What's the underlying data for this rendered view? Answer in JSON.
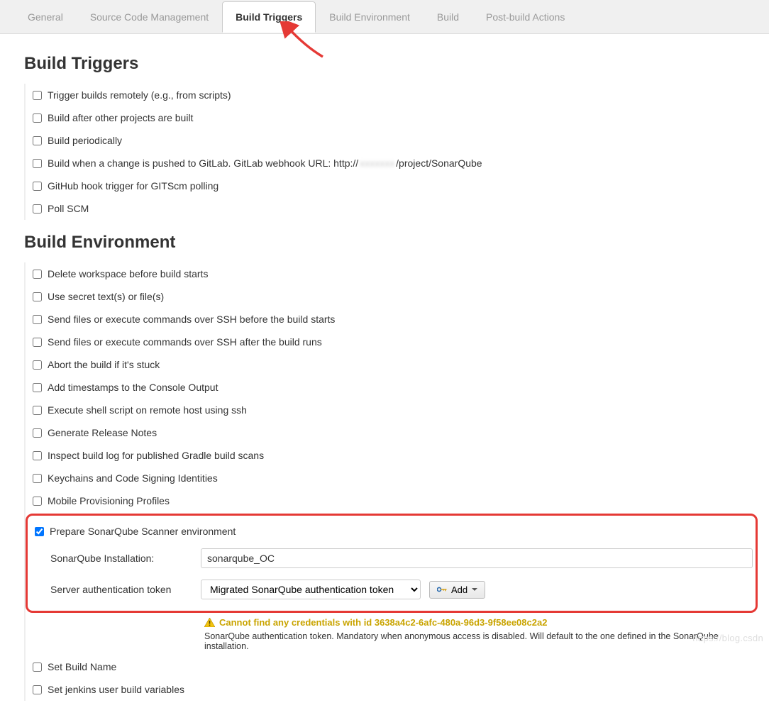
{
  "tabs": {
    "general": "General",
    "scm": "Source Code Management",
    "build_triggers": "Build Triggers",
    "build_env": "Build Environment",
    "build": "Build",
    "post_build": "Post-build Actions"
  },
  "sections": {
    "build_triggers_title": "Build Triggers",
    "build_env_title": "Build Environment"
  },
  "triggers": {
    "remote": "Trigger builds remotely (e.g., from scripts)",
    "after_other": "Build after other projects are built",
    "periodic": "Build periodically",
    "gitlab_prefix": "Build when a change is pushed to GitLab. GitLab webhook URL: http://",
    "gitlab_hidden": "xxxxxxx",
    "gitlab_suffix": "/project/SonarQube",
    "github_scm": "GitHub hook trigger for GITScm polling",
    "poll_scm": "Poll SCM"
  },
  "env": {
    "delete_ws": "Delete workspace before build starts",
    "secret": "Use secret text(s) or file(s)",
    "ssh_before": "Send files or execute commands over SSH before the build starts",
    "ssh_after": "Send files or execute commands over SSH after the build runs",
    "abort_stuck": "Abort the build if it's stuck",
    "timestamps": "Add timestamps to the Console Output",
    "remote_shell": "Execute shell script on remote host using ssh",
    "release_notes": "Generate Release Notes",
    "gradle_scan": "Inspect build log for published Gradle build scans",
    "keychains": "Keychains and Code Signing Identities",
    "mobile_prov": "Mobile Provisioning Profiles",
    "prepare_sonar": "Prepare SonarQube Scanner environment",
    "set_build_name": "Set Build Name",
    "set_jenkins_vars": "Set jenkins user build variables"
  },
  "sonar": {
    "install_label": "SonarQube Installation:",
    "install_value": "sonarqube_OC",
    "token_label": "Server authentication token",
    "token_value": "Migrated SonarQube authentication token",
    "add_label": "Add",
    "warn": "Cannot find any credentials with id 3638a4c2-6afc-480a-96d3-9f58ee08c2a2",
    "help": "SonarQube authentication token. Mandatory when anonymous access is disabled. Will default to the one defined in the SonarQube installation."
  },
  "watermark": "https://blog.csdn"
}
